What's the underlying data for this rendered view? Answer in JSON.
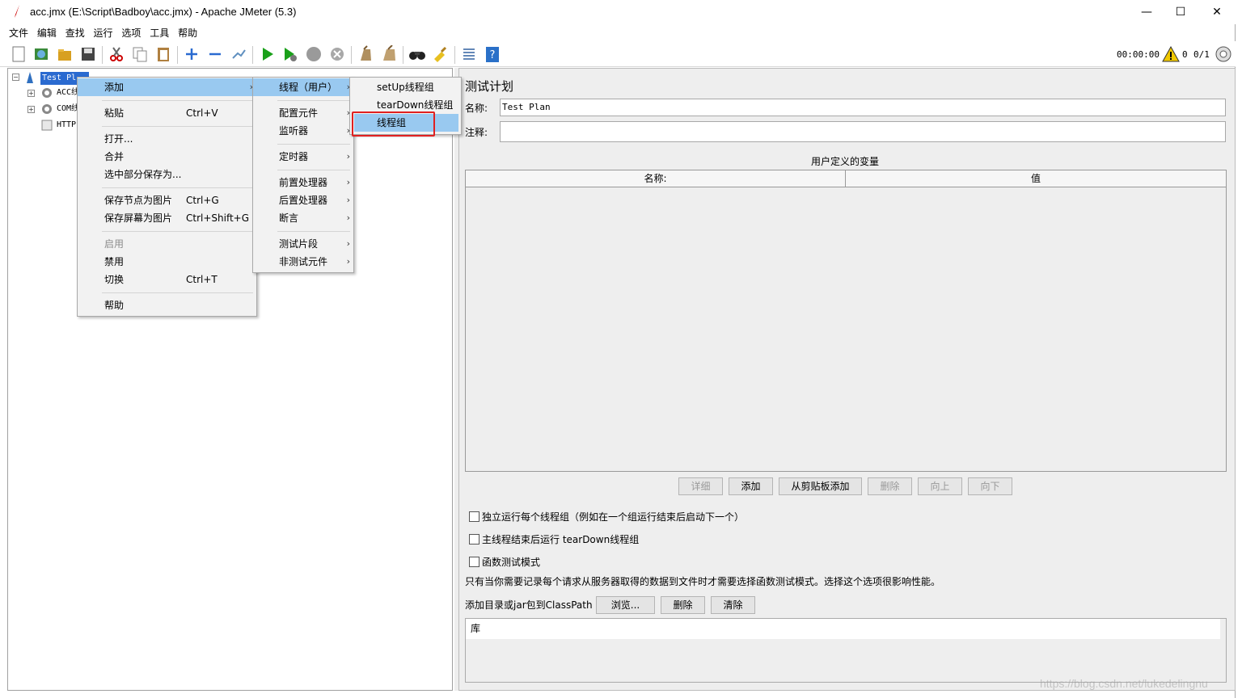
{
  "window": {
    "title": "acc.jmx (E:\\Script\\Badboy\\acc.jmx) - Apache JMeter (5.3)",
    "minimize": "—",
    "maximize": "☐",
    "close": "✕"
  },
  "menubar": [
    "文件",
    "编辑",
    "查找",
    "运行",
    "选项",
    "工具",
    "帮助"
  ],
  "status": {
    "elapsed": "00:00:00",
    "warnings": "0",
    "threads": "0/1"
  },
  "tree": {
    "root": "Test Pl",
    "items": [
      "ACC线",
      "COM线",
      "HTTP"
    ]
  },
  "context_menu": {
    "items": [
      {
        "label": "添加",
        "shortcut": ""
      },
      {
        "label": "粘贴",
        "shortcut": "Ctrl+V"
      },
      {
        "label": "打开...",
        "shortcut": ""
      },
      {
        "label": "合并",
        "shortcut": ""
      },
      {
        "label": "选中部分保存为...",
        "shortcut": ""
      },
      {
        "label": "保存节点为图片",
        "shortcut": "Ctrl+G"
      },
      {
        "label": "保存屏幕为图片",
        "shortcut": "Ctrl+Shift+G"
      },
      {
        "label": "启用",
        "shortcut": ""
      },
      {
        "label": "禁用",
        "shortcut": ""
      },
      {
        "label": "切换",
        "shortcut": "Ctrl+T"
      },
      {
        "label": "帮助",
        "shortcut": ""
      }
    ]
  },
  "add_submenu": {
    "items": [
      "线程（用户）",
      "配置元件",
      "监听器",
      "定时器",
      "前置处理器",
      "后置处理器",
      "断言",
      "测试片段",
      "非测试元件"
    ]
  },
  "thread_submenu": {
    "items": [
      "setUp线程组",
      "tearDown线程组",
      "线程组"
    ]
  },
  "panel": {
    "heading": "测试计划",
    "name_label": "名称:",
    "name_value": "Test Plan",
    "comment_label": "注释:",
    "comment_value": "",
    "vars_title": "用户定义的变量",
    "col_name": "名称:",
    "col_value": "值",
    "buttons": [
      "详细",
      "添加",
      "从剪贴板添加",
      "删除",
      "向上",
      "向下"
    ],
    "cb_independent": "独立运行每个线程组（例如在一个组运行结束后启动下一个）",
    "cb_teardown": "主线程结束后运行 tearDown线程组",
    "cb_functional": "函数测试模式",
    "functional_note": "只有当你需要记录每个请求从服务器取得的数据到文件时才需要选择函数测试模式。选择这个选项很影响性能。",
    "classpath_label": "添加目录或jar包到ClassPath",
    "browse": "浏览...",
    "delete": "删除",
    "clear": "清除",
    "lib_header": "库"
  },
  "watermark": "https://blog.csdn.net/lukedelingnu"
}
